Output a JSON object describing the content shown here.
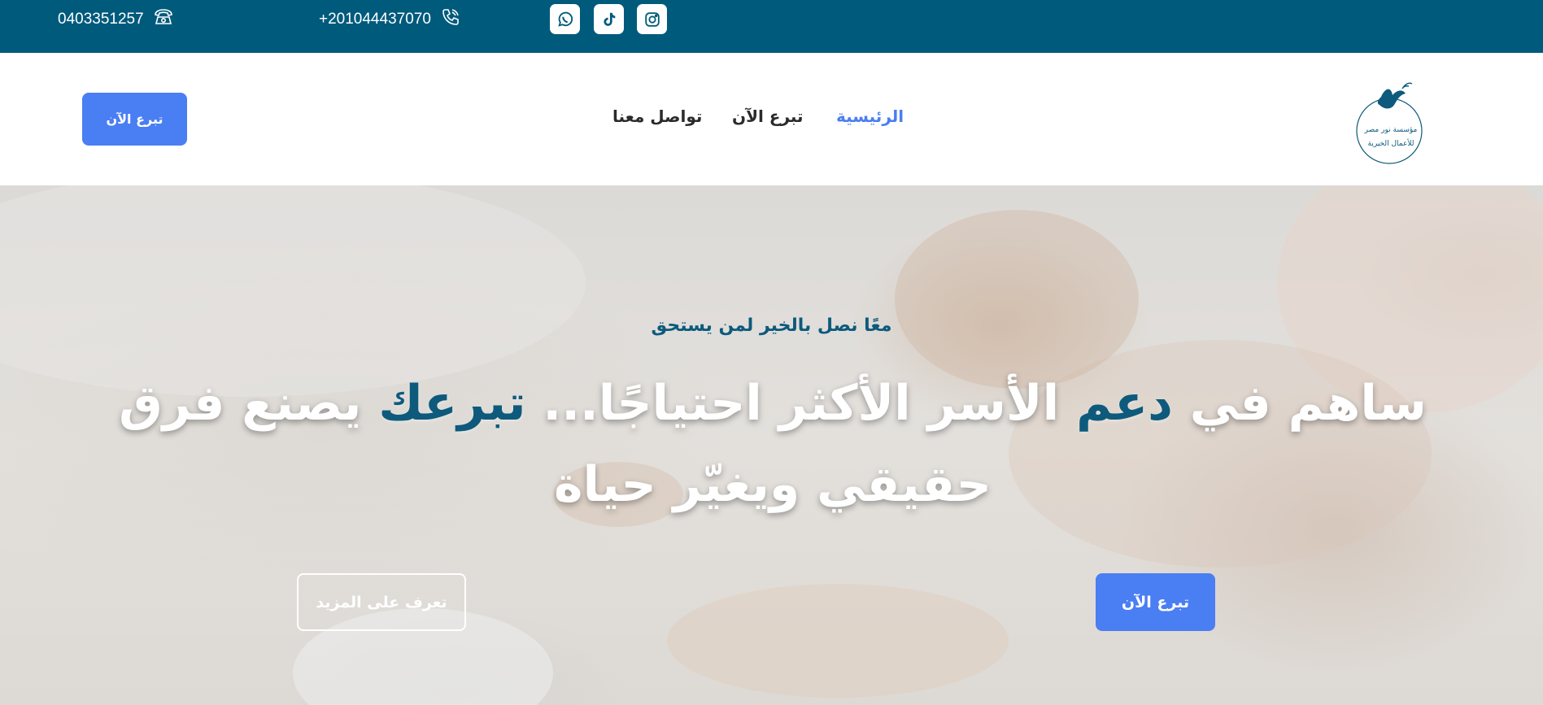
{
  "topbar": {
    "phone_landline": "0403351257",
    "phone_mobile": "+201044437070",
    "social": [
      {
        "icon": "whatsapp-icon",
        "name": "WhatsApp"
      },
      {
        "icon": "tiktok-icon",
        "name": "TikTok"
      },
      {
        "icon": "instagram-icon",
        "name": "Instagram"
      }
    ],
    "background": "#005a7c"
  },
  "header": {
    "donate_button": "تبرع الآن",
    "nav": {
      "home": "الرئيسية",
      "donate": "تبرع الآن",
      "contact": "تواصل معنا"
    },
    "logo_text": [
      "مؤسسة نور مصر",
      "للأعمال الخيرية"
    ]
  },
  "hero": {
    "tagline": "معًا نصل بالخير لمن يستحق",
    "title_part1": "ساهم في ",
    "title_highlight1": "دعم",
    "title_part2": " الأسر الأكثر احتياجًا... ",
    "title_highlight2": "تبرعك",
    "title_part3": " يصنع فرق حقيقي ويغيّر حياة",
    "donate_button": "تبرع الآن",
    "learn_more_button": "تعرف على المزيد"
  },
  "colors": {
    "accent": "#4a7ef3",
    "brand": "#0d5a7c",
    "topbar": "#005a7c"
  }
}
